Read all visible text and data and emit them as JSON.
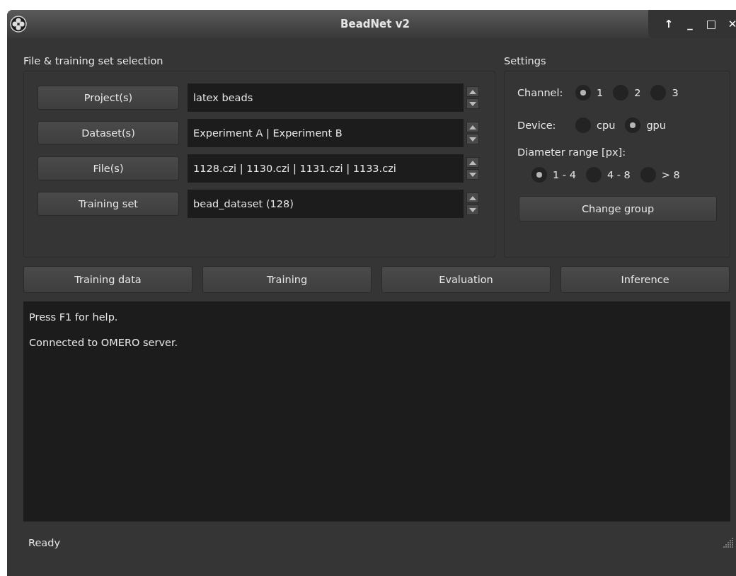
{
  "window": {
    "title": "BeadNet v2",
    "controls": [
      "↑",
      "_",
      "□",
      "✕"
    ]
  },
  "file_selection": {
    "title": "File & training set selection",
    "rows": [
      {
        "button": "Project(s)",
        "value": "latex beads"
      },
      {
        "button": "Dataset(s)",
        "value": "Experiment A | Experiment B"
      },
      {
        "button": "File(s)",
        "value": "1128.czi | 1130.czi | 1131.czi | 1133.czi"
      },
      {
        "button": "Training set",
        "value": "bead_dataset (128)"
      }
    ]
  },
  "settings": {
    "title": "Settings",
    "channel": {
      "label": "Channel:",
      "options": [
        {
          "label": "1",
          "selected": true
        },
        {
          "label": "2",
          "selected": false
        },
        {
          "label": "3",
          "selected": false
        }
      ]
    },
    "device": {
      "label": "Device:",
      "options": [
        {
          "label": "cpu",
          "selected": false
        },
        {
          "label": "gpu",
          "selected": true
        }
      ]
    },
    "diameter": {
      "label": "Diameter range [px]:",
      "options": [
        {
          "label": "1 - 4",
          "selected": true
        },
        {
          "label": "4 - 8",
          "selected": false
        },
        {
          "label": "> 8",
          "selected": false
        }
      ]
    },
    "button": "Change group"
  },
  "actions": [
    "Training data",
    "Training",
    "Evaluation",
    "Inference"
  ],
  "log": [
    "Press F1 for help.",
    "Connected to OMERO server."
  ],
  "status_bar": "Ready"
}
